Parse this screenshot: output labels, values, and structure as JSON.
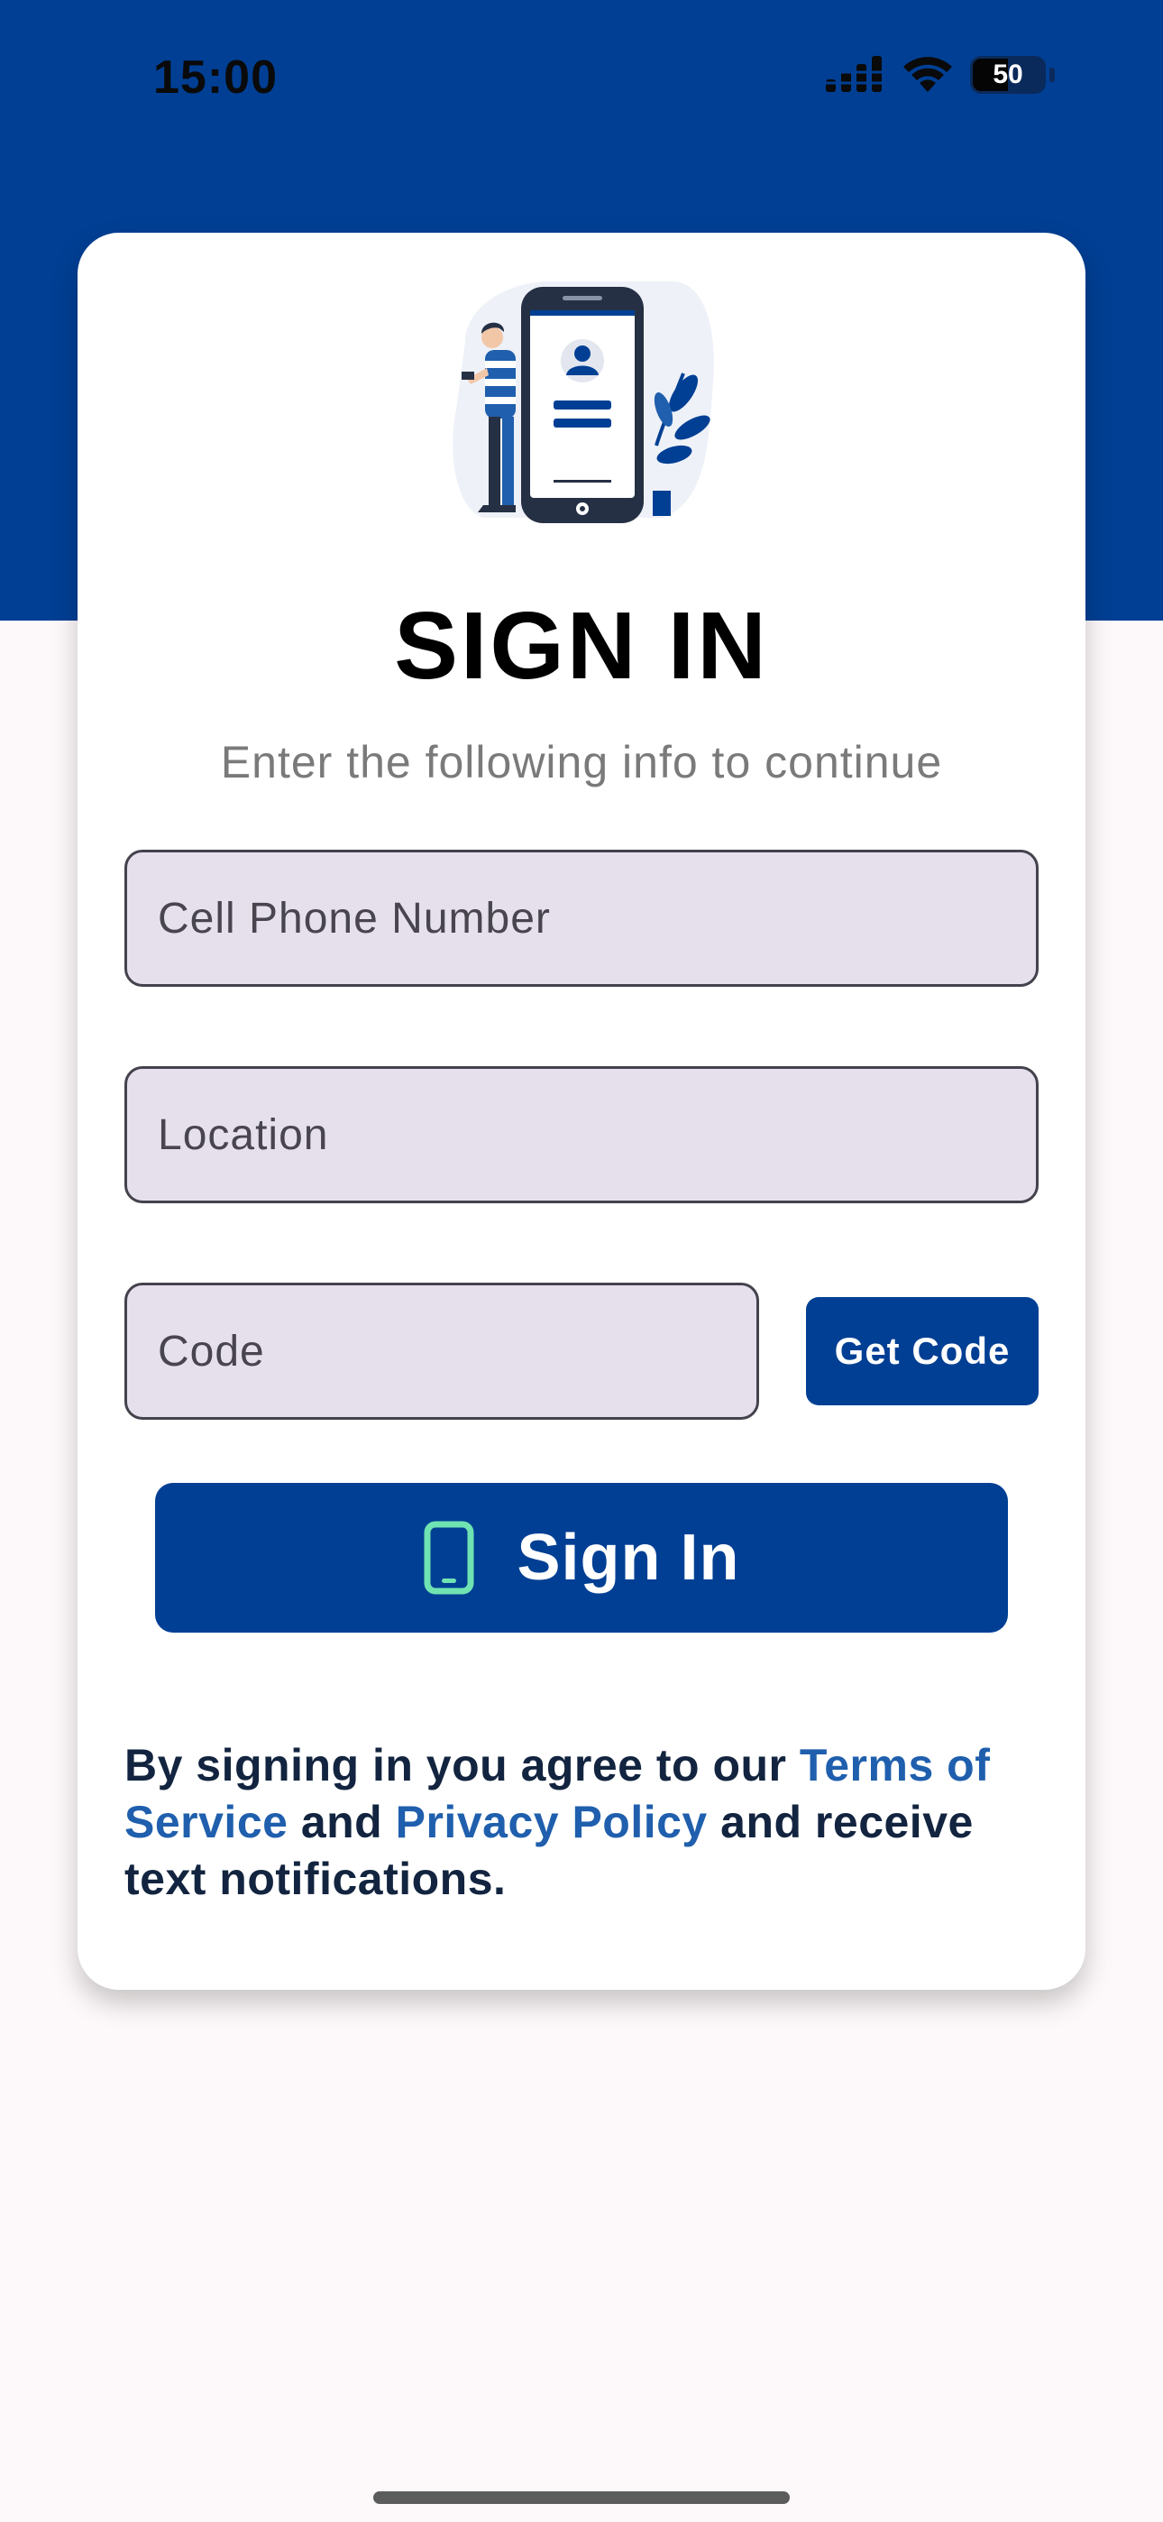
{
  "status_bar": {
    "time": "15:00",
    "battery_level": "50",
    "battery_fraction": 0.5
  },
  "card": {
    "title": "SIGN IN",
    "subtitle": "Enter the following info to continue"
  },
  "form": {
    "phone_placeholder": "Cell Phone Number",
    "phone_value": "",
    "location_placeholder": "Location",
    "location_value": "",
    "code_placeholder": "Code",
    "code_value": "",
    "get_code_label": "Get Code",
    "sign_in_label": "Sign In"
  },
  "legal": {
    "prefix": "By signing in you agree to our ",
    "terms_link": "Terms of Service",
    "middle": " and ",
    "privacy_link": "Privacy Policy",
    "suffix": " and receive text notifications."
  },
  "colors": {
    "brand": "#003f94",
    "link": "#1f5fad",
    "phone_icon": "#6fe3b1",
    "background": "#fdf9fa"
  },
  "icons": {
    "signal": "cellular-signal-icon",
    "wifi": "wifi-icon",
    "battery": "battery-icon",
    "sign_in": "smartphone-icon"
  }
}
